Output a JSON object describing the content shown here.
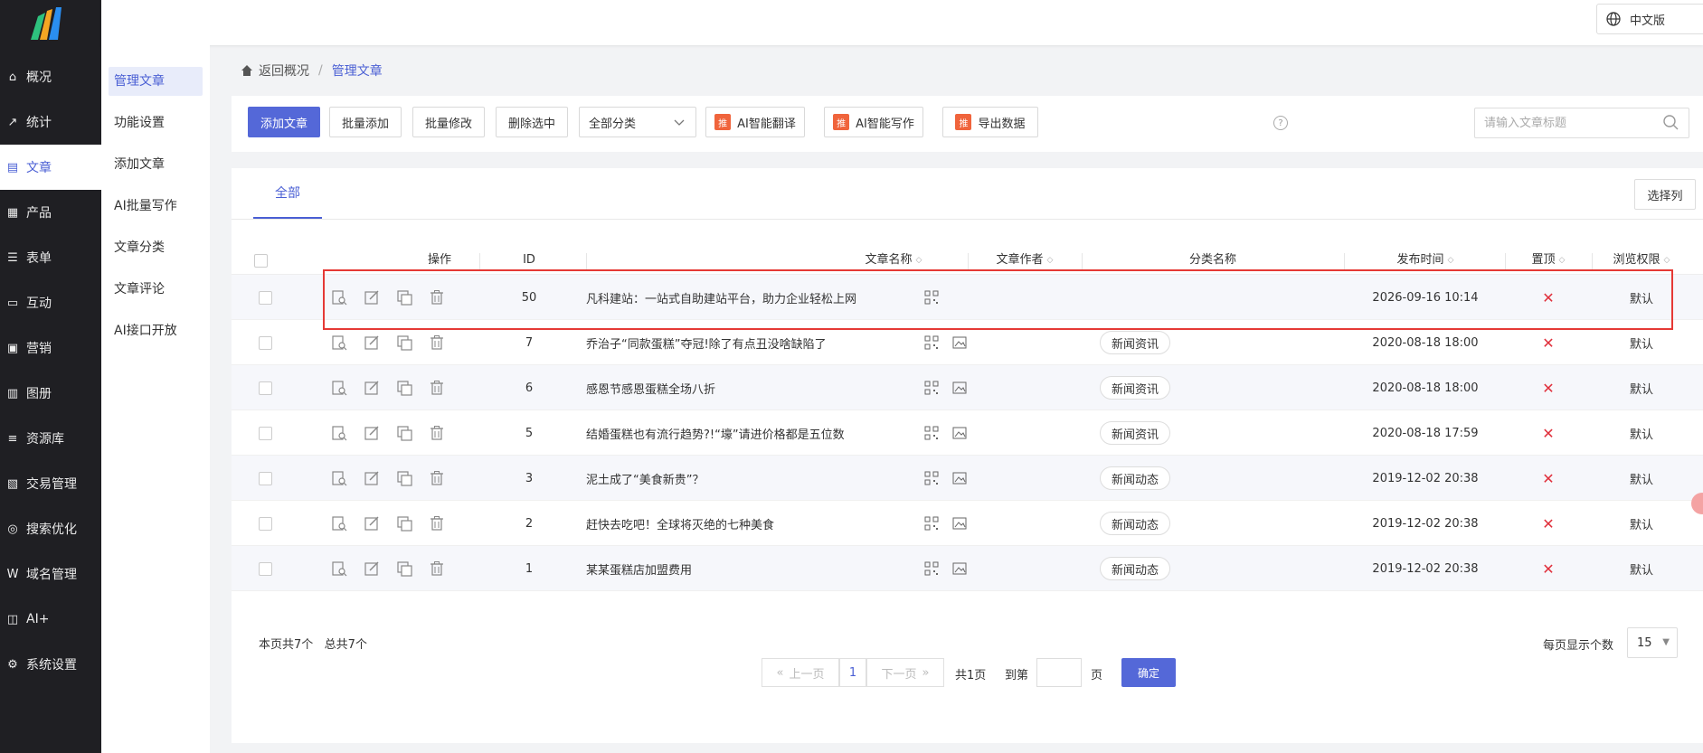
{
  "nav": {
    "items": [
      {
        "label": "概况",
        "icon": "home-icon"
      },
      {
        "label": "统计",
        "icon": "chart-icon"
      },
      {
        "label": "文章",
        "icon": "article-icon"
      },
      {
        "label": "产品",
        "icon": "grid-icon"
      },
      {
        "label": "表单",
        "icon": "form-icon"
      },
      {
        "label": "互动",
        "icon": "chat-icon"
      },
      {
        "label": "营销",
        "icon": "gift-icon"
      },
      {
        "label": "图册",
        "icon": "album-icon"
      },
      {
        "label": "资源库",
        "icon": "database-icon"
      },
      {
        "label": "交易管理",
        "icon": "wallet-icon"
      },
      {
        "label": "搜索优化",
        "icon": "seo-icon"
      },
      {
        "label": "域名管理",
        "icon": "domain-icon"
      },
      {
        "label": "AI+",
        "icon": "robot-icon"
      },
      {
        "label": "系统设置",
        "icon": "gear-icon"
      }
    ],
    "active_index": 2
  },
  "subnav": {
    "items": [
      "管理文章",
      "功能设置",
      "添加文章",
      "AI批量写作",
      "文章分类",
      "文章评论",
      "AI接口开放"
    ]
  },
  "topbar": {
    "lang": "中文版"
  },
  "breadcrumb": {
    "home": "返回概况",
    "sep": "/",
    "current": "管理文章"
  },
  "toolbar": {
    "add": "添加文章",
    "batch_add": "批量添加",
    "batch_edit": "批量修改",
    "delete_selected": "删除选中",
    "category_select": "全部分类",
    "ai_badge": "推",
    "ai_translate": "AI智能翻译",
    "ai_write": "AI智能写作",
    "export": "导出数据",
    "help": "?",
    "search_placeholder": "请输入文章标题"
  },
  "tabs": {
    "all": "全部"
  },
  "select_columns": "选择列",
  "table": {
    "headers": {
      "op": "操作",
      "id": "ID",
      "title": "文章名称",
      "author": "文章作者",
      "category": "分类名称",
      "time": "发布时间",
      "top": "置顶",
      "perm": "浏览权限"
    },
    "rows": [
      {
        "id": "50",
        "title": "凡科建站：一站式自助建站平台，助力企业轻松上网",
        "category": "",
        "time": "2026-09-16 10:14",
        "top": "✕",
        "perm": "默认",
        "has_image": false
      },
      {
        "id": "7",
        "title": "乔治子“同款蛋糕”夺冠!除了有点丑没啥缺陷了",
        "category": "新闻资讯",
        "time": "2020-08-18 18:00",
        "top": "✕",
        "perm": "默认",
        "has_image": true
      },
      {
        "id": "6",
        "title": "感恩节感恩蛋糕全场八折",
        "category": "新闻资讯",
        "time": "2020-08-18 18:00",
        "top": "✕",
        "perm": "默认",
        "has_image": true
      },
      {
        "id": "5",
        "title": "结婚蛋糕也有流行趋势?!“壕”请进价格都是五位数",
        "category": "新闻资讯",
        "time": "2020-08-18 17:59",
        "top": "✕",
        "perm": "默认",
        "has_image": true
      },
      {
        "id": "3",
        "title": "泥土成了“美食新贵”？",
        "category": "新闻动态",
        "time": "2019-12-02 20:38",
        "top": "✕",
        "perm": "默认",
        "has_image": true
      },
      {
        "id": "2",
        "title": "赶快去吃吧！全球将灭绝的七种美食",
        "category": "新闻动态",
        "time": "2019-12-02 20:38",
        "top": "✕",
        "perm": "默认",
        "has_image": true
      },
      {
        "id": "1",
        "title": "某某蛋糕店加盟费用",
        "category": "新闻动态",
        "time": "2019-12-02 20:38",
        "top": "✕",
        "perm": "默认",
        "has_image": true
      }
    ]
  },
  "footer": {
    "summary": "本页共7个   总共7个",
    "prev": "上一页",
    "page": "1",
    "next": "下一页",
    "total_pages": "共1页",
    "goto": "到第",
    "page_unit": "页",
    "confirm": "确定",
    "per_page_label": "每页显示个数",
    "per_page": "15"
  },
  "colors": {
    "accent": "#5468d8",
    "danger": "#e0303c",
    "highlight_box": "#e53935"
  }
}
